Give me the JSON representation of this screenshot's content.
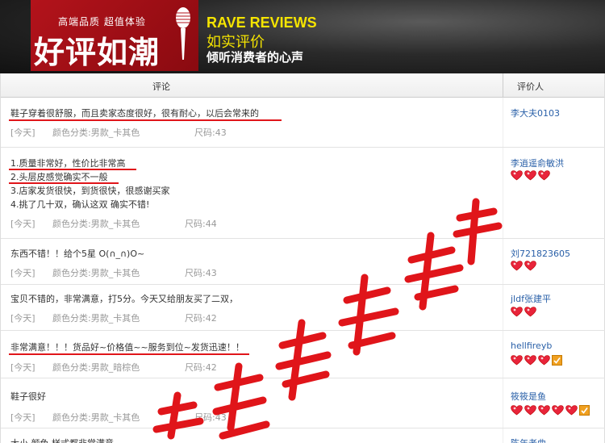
{
  "banner": {
    "tagline": "高端品质  超值体验",
    "big_title": "好评如潮",
    "en_title": "RAVE REVIEWS",
    "cn_sub1": "如实评价",
    "cn_sub2": "倾听消费者的心声"
  },
  "table": {
    "col_comment": "评论",
    "col_reviewer": "评价人"
  },
  "rows": [
    {
      "lines": [
        "鞋子穿着很舒服，而且卖家态度很好，很有耐心，以后会常来的"
      ],
      "date": "[今天]",
      "color": "颜色分类:男款_卡其色",
      "size": "尺码:43",
      "user": "李大夫0103",
      "hearts": 0,
      "extra": ""
    },
    {
      "lines": [
        "1.质量非常好，性价比非常高",
        "2.头层皮感觉确实不一般",
        "3.店家发货很快，到货很快，很感谢买家",
        "4.挑了几十双，确认这双 确实不错!"
      ],
      "date": "[今天]",
      "color": "颜色分类:男款_卡其色",
      "size": "尺码:44",
      "user": "李逍遥俞敏洪",
      "hearts": 3,
      "extra": ""
    },
    {
      "lines": [
        "东西不错！！给个5星 O(∩_∩)O~"
      ],
      "date": "[今天]",
      "color": "颜色分类:男款_卡其色",
      "size": "尺码:43",
      "user": "刘721823605",
      "hearts": 2,
      "extra": ""
    },
    {
      "lines": [
        "宝贝不错的，非常满意，打5分。今天又给朋友买了二双，"
      ],
      "date": "[今天]",
      "color": "颜色分类:男款_卡其色",
      "size": "尺码:42",
      "user": "jldf张建平",
      "hearts": 2,
      "extra": ""
    },
    {
      "lines": [
        "非常满意！！！货品好~价格值~~服务到位~发货迅速！！"
      ],
      "date": "[今天]",
      "color": "颜色分类:男款_暗棕色",
      "size": "尺码:42",
      "user": "hellfireyb",
      "hearts": 3,
      "extra": "badge"
    },
    {
      "lines": [
        "鞋子很好"
      ],
      "date": "[今天]",
      "color": "颜色分类:男款_卡其色",
      "size": "尺码:43",
      "user": "筱筱是鱼",
      "hearts": 5,
      "extra": "badge"
    },
    {
      "lines": [
        "大小 颜色 样式都非常满意"
      ],
      "date": "",
      "color": "",
      "size": "",
      "user": "陈年老曲",
      "hearts": 0,
      "extra": ""
    }
  ],
  "watermark": "绝对真实评论",
  "colors": {
    "link": "#2a60a8",
    "underline": "#e0151a",
    "banner_red": "#b3131b",
    "banner_yellow": "#f5e400"
  }
}
